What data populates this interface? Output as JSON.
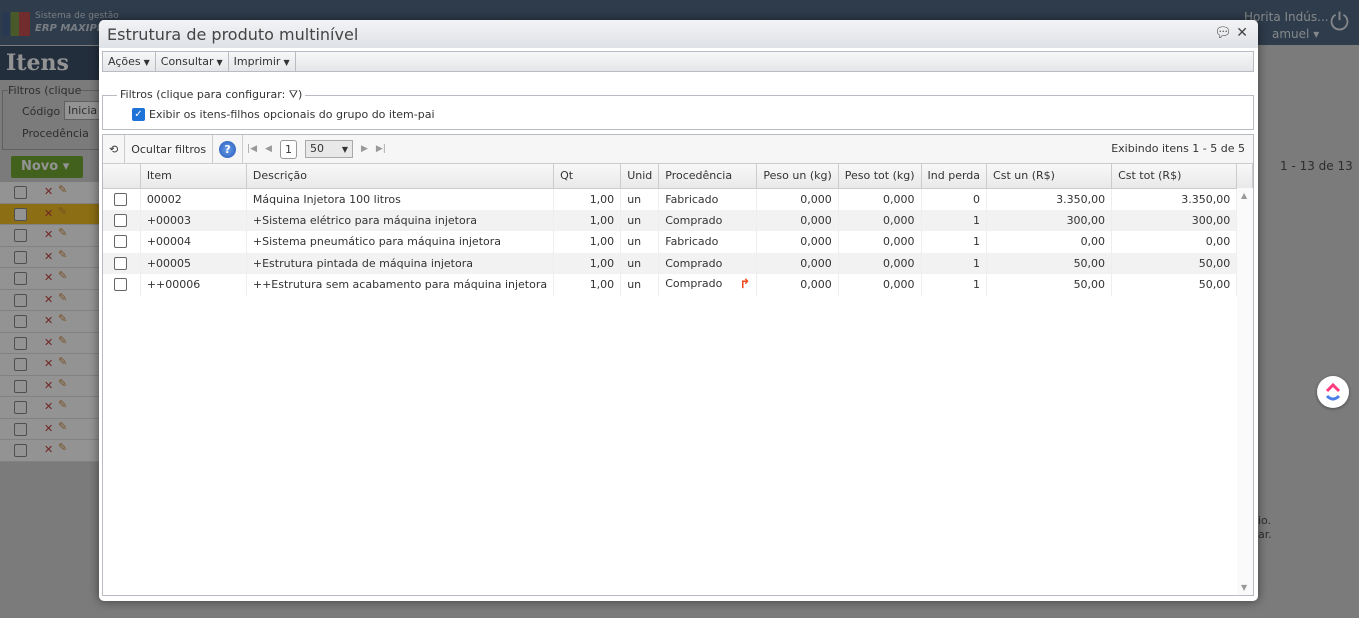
{
  "background": {
    "system_label": "Sistema de gestão",
    "erp_label": "ERP MAXIPRO",
    "page_title": "Itens",
    "company": "Horita Indús...",
    "user": "amuel",
    "filters_legend": "Filtros (clique",
    "codigo_label": "Código",
    "codigo_value": "Inicia",
    "procedencia_label": "Procedência",
    "novo_label": "Novo",
    "count": "1 - 13 de 13",
    "note1": "io.",
    "note2": "ar.",
    "row_count": 13
  },
  "modal": {
    "title": "Estrutura de produto multinível",
    "menus": [
      "Ações",
      "Consultar",
      "Imprimir"
    ],
    "filters_legend": "Filtros (clique para configurar:",
    "filters_legend_end": ")",
    "filter_checkbox_label": "Exibir os itens-filhos opcionais do grupo do item-pai",
    "hide_filters": "Ocultar filtros",
    "help": "?",
    "page": "1",
    "page_size": "50",
    "showing": "Exibindo itens 1 - 5 de 5",
    "columns": [
      "Item",
      "Descrição",
      "Qt",
      "Unid",
      "Procedência",
      "Peso un (kg)",
      "Peso tot (kg)",
      "Ind perda",
      "Cst un (R$)",
      "Cst tot (R$)"
    ],
    "rows": [
      [
        "00002",
        "Máquina Injetora 100 litros",
        "1,00",
        "un",
        "Fabricado",
        "0,000",
        "0,000",
        "0",
        "3.350,00",
        "3.350,00"
      ],
      [
        "+00003",
        "+Sistema elétrico para máquina injetora",
        "1,00",
        "un",
        "Comprado",
        "0,000",
        "0,000",
        "1",
        "300,00",
        "300,00"
      ],
      [
        "+00004",
        "+Sistema pneumático para máquina injetora",
        "1,00",
        "un",
        "Fabricado",
        "0,000",
        "0,000",
        "1",
        "0,00",
        "0,00"
      ],
      [
        "+00005",
        "+Estrutura pintada de máquina injetora",
        "1,00",
        "un",
        "Comprado",
        "0,000",
        "0,000",
        "1",
        "50,00",
        "50,00"
      ],
      [
        "++00006",
        "++Estrutura sem acabamento para máquina injetora",
        "1,00",
        "un",
        "Comprado",
        "0,000",
        "0,000",
        "1",
        "50,00",
        "50,00"
      ]
    ]
  }
}
